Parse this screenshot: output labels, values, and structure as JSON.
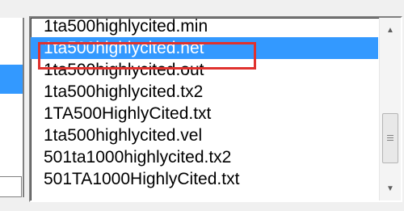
{
  "file_list": {
    "items": [
      {
        "label": "1ta500highlycited.min",
        "selected": false
      },
      {
        "label": "1ta500highlycited.net",
        "selected": true
      },
      {
        "label": "1ta500highlycited.out",
        "selected": false
      },
      {
        "label": "1ta500highlycited.tx2",
        "selected": false
      },
      {
        "label": "1TA500HighlyCited.txt",
        "selected": false
      },
      {
        "label": "1ta500highlycited.vel",
        "selected": false
      },
      {
        "label": "501ta1000highlycited.tx2",
        "selected": false
      },
      {
        "label": "501TA1000HighlyCited.txt",
        "selected": false
      }
    ],
    "selection_color": "#3399ff",
    "annotation_color": "#e0322e"
  },
  "scrollbar": {
    "up_icon": "scroll-up-arrow-icon",
    "down_icon": "scroll-down-arrow-icon"
  }
}
